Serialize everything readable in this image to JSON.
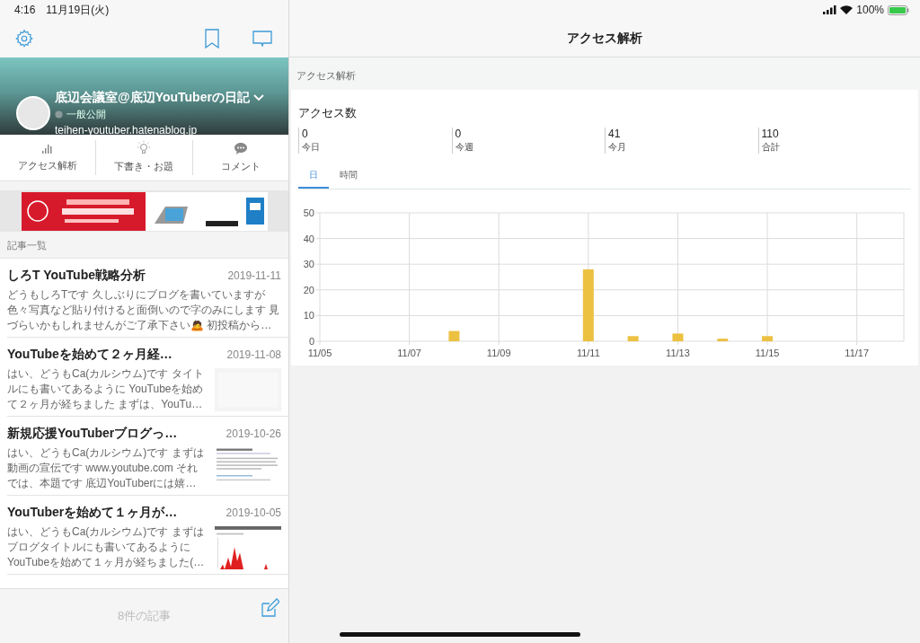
{
  "status_bar": {
    "time": "4:16",
    "date": "11月19日(火)",
    "battery": "100%"
  },
  "sidebar": {
    "blog": {
      "title": "底辺会議室@底辺YouTuberの日記",
      "visibility": "一般公開",
      "url": "teihen-youtuber.hatenablog.jp"
    },
    "menu": [
      {
        "label": "アクセス解析",
        "kind": "chart"
      },
      {
        "label": "下書き・お題",
        "kind": "bulb"
      },
      {
        "label": "コメント",
        "kind": "comment"
      }
    ],
    "section_label": "記事一覧",
    "articles": [
      {
        "title": "しろT YouTube戦略分析",
        "date": "2019-11-11",
        "excerpt": "どうもしろTです 久しぶりにブログを書いていますが色々写真など貼り付けると面倒いので字のみにします 見づらいかもしれませんがご了承下さい🙇 初投稿から…"
      },
      {
        "title": "YouTubeを始めて２ヶ月経…",
        "date": "2019-11-08",
        "excerpt": "はい、どうもCa(カルシウム)です タイトルにも書いてあるように YouTubeを始めて２ヶ月が経ちました まずは、YouTu…"
      },
      {
        "title": "新規応援YouTuberブログっ…",
        "date": "2019-10-26",
        "excerpt": "はい、どうもCa(カルシウム)です まずは動画の宣伝です www.youtube.com それでは、本題です 底辺YouTuberには嬉…"
      },
      {
        "title": "YouTuberを始めて１ヶ月が…",
        "date": "2019-10-05",
        "excerpt": "はい、どうもCa(カルシウム)です まずはブログタイトルにも書いてあるように YouTubeを始めて１ヶ月が経ちました(…"
      }
    ],
    "footer": "8件の記事"
  },
  "main": {
    "title": "アクセス解析",
    "section_label": "アクセス解析",
    "card_title": "アクセス数",
    "stats": [
      {
        "value": "0",
        "label": "今日"
      },
      {
        "value": "0",
        "label": "今週"
      },
      {
        "value": "41",
        "label": "今月"
      },
      {
        "value": "110",
        "label": "合計"
      }
    ],
    "tabs": [
      {
        "label": "日",
        "selected": true
      },
      {
        "label": "時間",
        "selected": false
      }
    ],
    "chart_data": {
      "type": "bar",
      "grid": true,
      "categories": [
        "11/05",
        null,
        "11/07",
        null,
        "11/09",
        null,
        "11/11",
        null,
        "11/13",
        null,
        "11/15",
        null,
        "11/17",
        null
      ],
      "series": [
        {
          "color": "#ecc141",
          "values": [
            0,
            0,
            0,
            4,
            0,
            0,
            28,
            2,
            3,
            1,
            2,
            0,
            0,
            0
          ]
        }
      ],
      "ylim": [
        0,
        50
      ],
      "yticks": [
        0,
        10,
        20,
        30,
        40,
        50
      ]
    }
  }
}
